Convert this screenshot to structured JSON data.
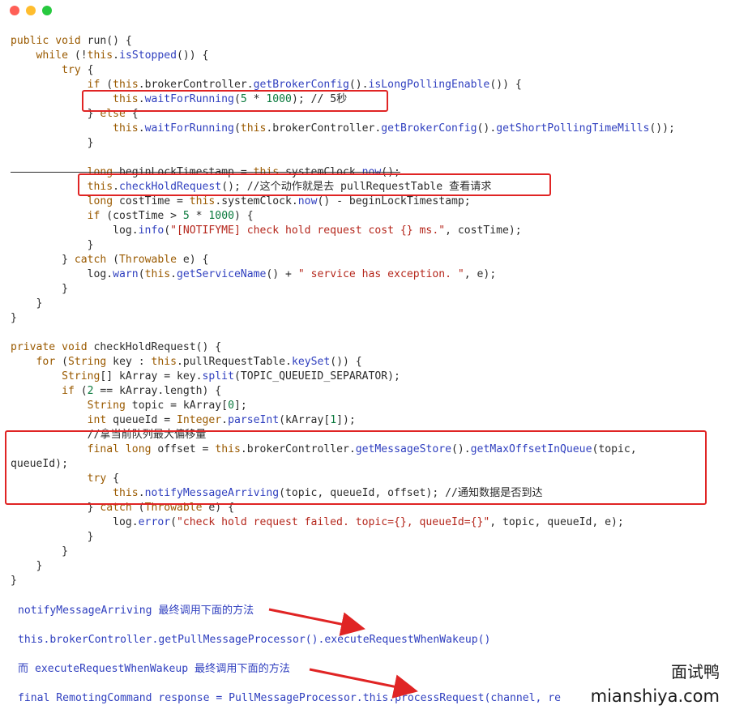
{
  "window": {
    "buttons": [
      "close",
      "minimize",
      "zoom"
    ],
    "colors": {
      "close": "#ff5f56",
      "minimize": "#ffbd2e",
      "zoom": "#27c93f",
      "highlight": "#e02424"
    }
  },
  "code_lines": [
    "public void run() {",
    "    while (!this.isStopped()) {",
    "        try {",
    "            if (this.brokerController.getBrokerConfig().isLongPollingEnable()) {",
    "                this.waitForRunning(5 * 1000); // 5秒",
    "            } else {",
    "                this.waitForRunning(this.brokerController.getBrokerConfig().getShortPollingTimeMills());",
    "            }",
    "",
    "            long beginLockTimestamp = this.systemClock.now();",
    "            this.checkHoldRequest(); //这个动作就是去 pullRequestTable 查看请求",
    "            long costTime = this.systemClock.now() - beginLockTimestamp;",
    "            if (costTime > 5 * 1000) {",
    "                log.info(\"[NOTIFYME] check hold request cost {} ms.\", costTime);",
    "            }",
    "        } catch (Throwable e) {",
    "            log.warn(this.getServiceName() + \" service has exception. \", e);",
    "        }",
    "    }",
    "}",
    "",
    "private void checkHoldRequest() {",
    "    for (String key : this.pullRequestTable.keySet()) {",
    "        String[] kArray = key.split(TOPIC_QUEUEID_SEPARATOR);",
    "        if (2 == kArray.length) {",
    "            String topic = kArray[0];",
    "            int queueId = Integer.parseInt(kArray[1]);",
    "            //拿当前队列最大偏移量",
    "            final long offset = this.brokerController.getMessageStore().getMaxOffsetInQueue(topic,",
    "queueId);",
    "            try {",
    "                this.notifyMessageArriving(topic, queueId, offset); //通知数据是否到达",
    "            } catch (Throwable e) {",
    "                log.error(\"check hold request failed. topic={}, queueId={}\", topic, queueId, e);",
    "            }",
    "        }",
    "    }",
    "}"
  ],
  "notes": [
    "notifyMessageArriving 最终调用下面的方法",
    "this.brokerController.getPullMessageProcessor().executeRequestWhenWakeup()",
    "而 executeRequestWhenWakeup 最终调用下面的方法",
    "final RemotingCommand response = PullMessageProcessor.this.processRequest(channel, re"
  ],
  "watermark": {
    "cn": "面试鸭",
    "en": "mianshiya.com"
  }
}
